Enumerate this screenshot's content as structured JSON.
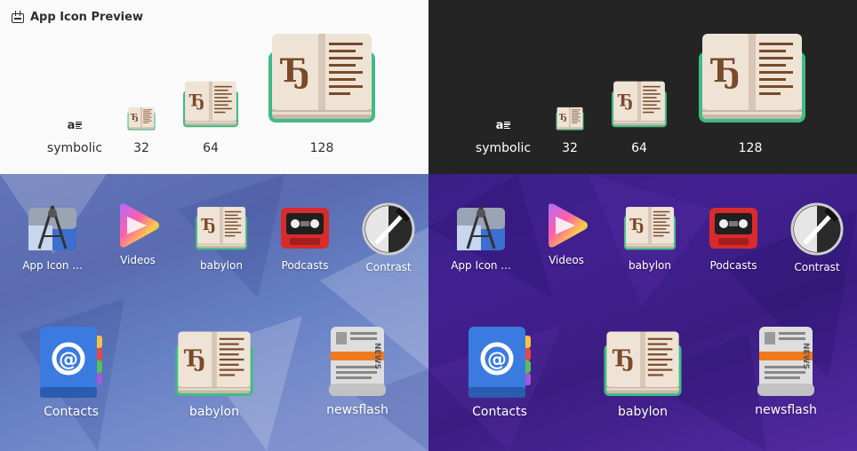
{
  "window": {
    "title": "App Icon Preview"
  },
  "preview": {
    "sizes": [
      "symbolic",
      "32",
      "64",
      "128"
    ],
    "symbolic_glyph": "a"
  },
  "book_glyph": "Ђ",
  "grid": {
    "small_row": [
      {
        "label": "App Icon ...",
        "icon": "app-icon-preview-icon"
      },
      {
        "label": "Videos",
        "icon": "videos-icon"
      },
      {
        "label": "babylon",
        "icon": "book-icon"
      },
      {
        "label": "Podcasts",
        "icon": "podcasts-icon"
      },
      {
        "label": "Contrast",
        "icon": "contrast-icon"
      }
    ],
    "big_row": [
      {
        "label": "Contacts",
        "icon": "contacts-icon"
      },
      {
        "label": "babylon",
        "icon": "book-icon"
      },
      {
        "label": "newsflash",
        "icon": "newsflash-icon"
      }
    ]
  },
  "colors": {
    "light_bg": "#fafafa",
    "dark_bg": "#242424",
    "grid_blue": "#6274b8",
    "grid_purple": "#3a1f86",
    "book_green": "#3ebc85",
    "book_page": "#efe3d6",
    "book_ink": "#7a4a2a"
  }
}
